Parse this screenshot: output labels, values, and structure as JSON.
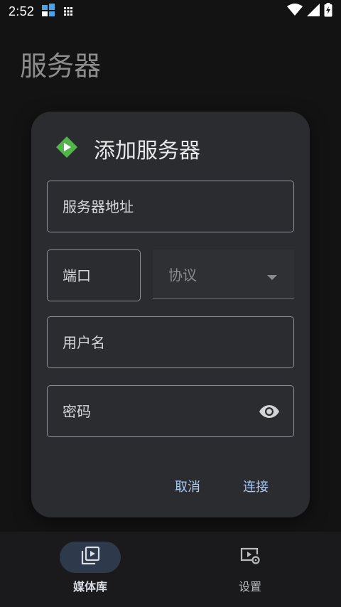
{
  "status_bar": {
    "time": "2:52"
  },
  "page": {
    "title": "服务器"
  },
  "dialog": {
    "title": "添加服务器",
    "fields": {
      "address_placeholder": "服务器地址",
      "port_placeholder": "端口",
      "protocol_placeholder": "协议",
      "username_placeholder": "用户名",
      "password_placeholder": "密码"
    },
    "buttons": {
      "cancel": "取消",
      "connect": "连接"
    }
  },
  "bottom_nav": {
    "items": [
      {
        "label": "媒体库",
        "selected": true
      },
      {
        "label": "设置",
        "selected": false
      }
    ]
  },
  "colors": {
    "brand_green": "#52b54b",
    "accent_blue": "#a9c9f5",
    "dialog_bg": "#2b2c30"
  },
  "icons": {
    "logo": "emby-logo-icon",
    "password_toggle": "eye-icon",
    "media": "video-library-icon",
    "settings": "video-settings-icon"
  }
}
